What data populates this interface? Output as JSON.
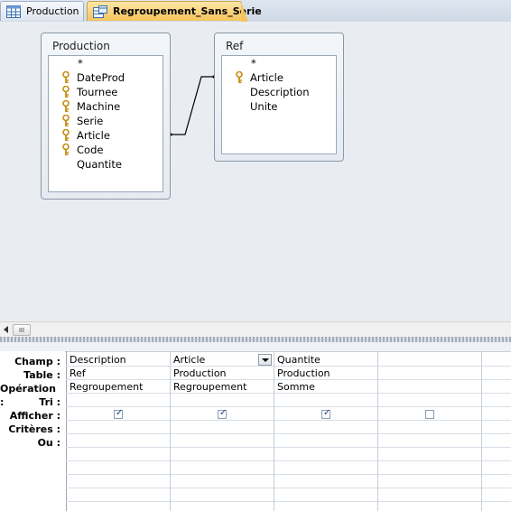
{
  "tabs": [
    {
      "label": "Production",
      "icon": "table-icon",
      "active": false
    },
    {
      "label": "Regroupement_Sans_Serie",
      "icon": "query-icon",
      "active": true
    }
  ],
  "tables": {
    "production": {
      "title": "Production",
      "fields": [
        {
          "name": "*",
          "key": false
        },
        {
          "name": "DateProd",
          "key": true
        },
        {
          "name": "Tournee",
          "key": true
        },
        {
          "name": "Machine",
          "key": true
        },
        {
          "name": "Serie",
          "key": true
        },
        {
          "name": "Article",
          "key": true
        },
        {
          "name": "Code",
          "key": true
        },
        {
          "name": "Quantite",
          "key": false
        }
      ]
    },
    "ref": {
      "title": "Ref",
      "fields": [
        {
          "name": "*",
          "key": false
        },
        {
          "name": "Article",
          "key": true
        },
        {
          "name": "Description",
          "key": false
        },
        {
          "name": "Unite",
          "key": false
        }
      ]
    }
  },
  "grid": {
    "row_labels": [
      "Champ :",
      "Table :",
      "Opération :",
      "Tri :",
      "Afficher :",
      "Critères :",
      "Ou :"
    ],
    "columns": [
      {
        "champ": "Description",
        "table": "Ref",
        "operation": "Regroupement",
        "tri": "",
        "afficher": true,
        "has_dropdown": false
      },
      {
        "champ": "Article",
        "table": "Production",
        "operation": "Regroupement",
        "tri": "",
        "afficher": true,
        "has_dropdown": true
      },
      {
        "champ": "Quantite",
        "table": "Production",
        "operation": "Somme",
        "tri": "",
        "afficher": true,
        "has_dropdown": false
      },
      {
        "champ": "",
        "table": "",
        "operation": "",
        "tri": "",
        "afficher": false,
        "has_dropdown": false
      }
    ]
  },
  "colors": {
    "active_tab": "#f6c45c",
    "diagram_bg": "#e9edf2",
    "key_icon": "#d9a21a"
  }
}
